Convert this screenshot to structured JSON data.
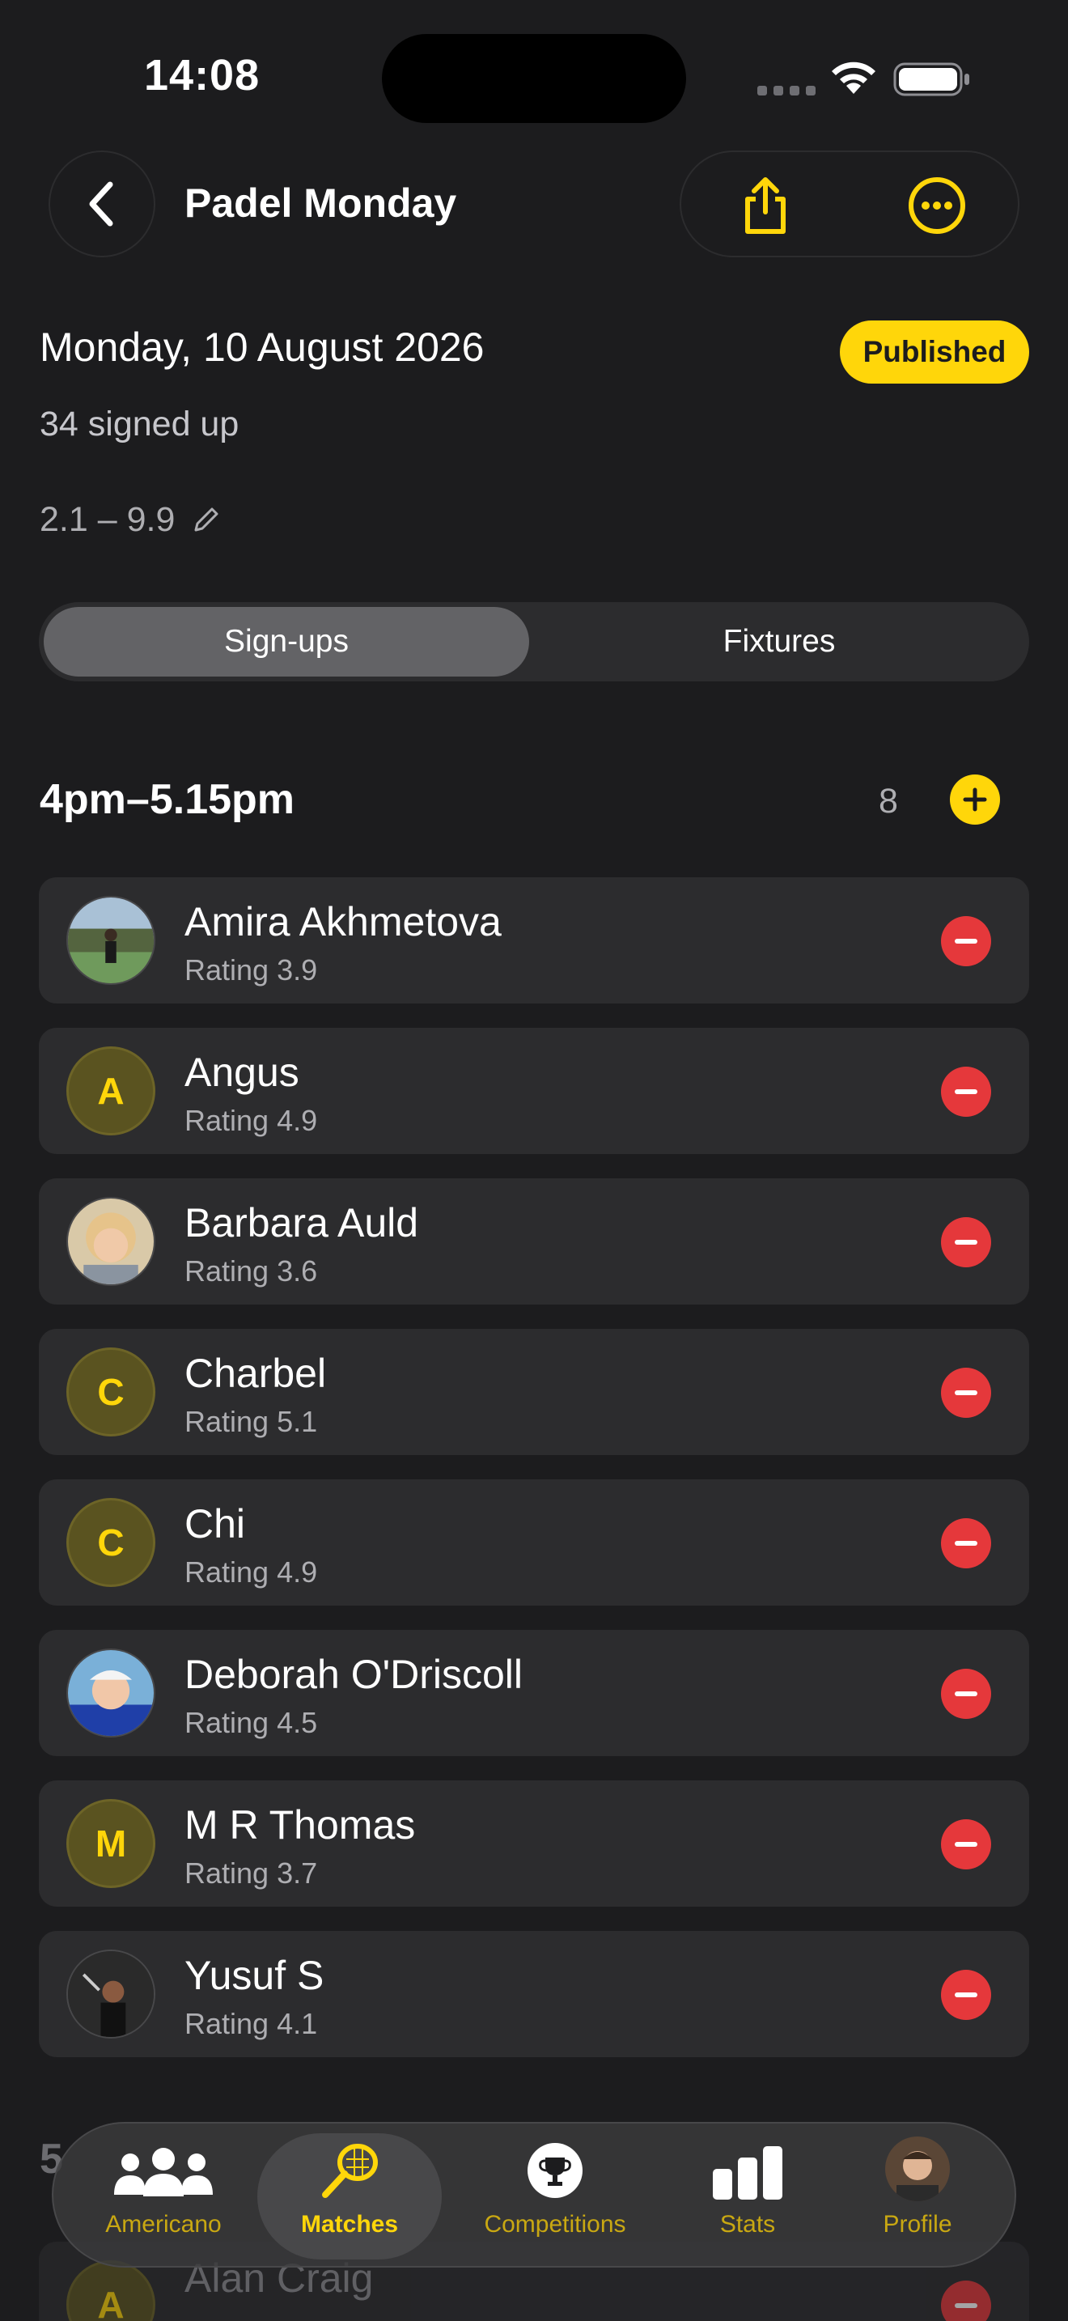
{
  "status_bar": {
    "time": "14:08"
  },
  "nav": {
    "title": "Padel Monday"
  },
  "header": {
    "date": "Monday, 10 August 2026",
    "status_badge": "Published",
    "signed_up": "34 signed up",
    "rating_range": "2.1 – 9.9"
  },
  "segments": {
    "tab1": "Sign-ups",
    "tab2": "Fixtures",
    "selected": "Sign-ups"
  },
  "session": {
    "title": "4pm–5.15pm",
    "count": "8",
    "players": [
      {
        "name": "Amira Akhmetova",
        "rating": "Rating 3.9",
        "avatar": "photo",
        "initial": ""
      },
      {
        "name": "Angus",
        "rating": "Rating 4.9",
        "avatar": "initial",
        "initial": "A"
      },
      {
        "name": "Barbara Auld",
        "rating": "Rating 3.6",
        "avatar": "photo",
        "initial": ""
      },
      {
        "name": "Charbel",
        "rating": "Rating 5.1",
        "avatar": "initial",
        "initial": "C"
      },
      {
        "name": "Chi",
        "rating": "Rating 4.9",
        "avatar": "initial",
        "initial": "C"
      },
      {
        "name": "Deborah O'Driscoll",
        "rating": "Rating 4.5",
        "avatar": "photo",
        "initial": ""
      },
      {
        "name": "M R Thomas",
        "rating": "Rating 3.7",
        "avatar": "initial",
        "initial": "M"
      },
      {
        "name": "Yusuf S",
        "rating": "Rating 4.1",
        "avatar": "photo",
        "initial": ""
      }
    ]
  },
  "next_session": {
    "title": "5",
    "first_player": {
      "name": "Alan Craig",
      "initial": "A"
    }
  },
  "tabbar": {
    "items": [
      {
        "label": "Americano",
        "icon": "people-icon"
      },
      {
        "label": "Matches",
        "icon": "racket-icon",
        "active": true
      },
      {
        "label": "Competitions",
        "icon": "trophy-icon"
      },
      {
        "label": "Stats",
        "icon": "bar-chart-icon"
      },
      {
        "label": "Profile",
        "icon": "avatar"
      }
    ]
  },
  "colors": {
    "accent": "#ffd60a",
    "danger": "#e5383b",
    "background": "#1c1c1e",
    "card": "#2c2c2e"
  }
}
